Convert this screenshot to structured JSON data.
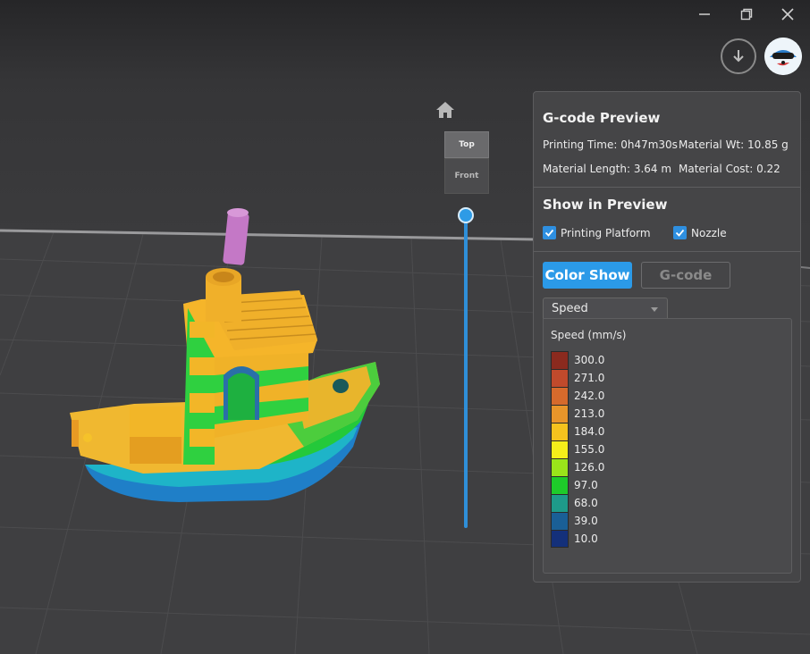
{
  "window": {
    "minimize_icon": "minimize-icon",
    "restore_icon": "restore-icon",
    "close_icon": "close-icon"
  },
  "toolbar": {
    "download_icon": "download-arrow-icon",
    "avatar_icon": "user-avatar"
  },
  "view_cube": {
    "home_icon": "home-icon",
    "top_label": "Top",
    "front_label": "Front"
  },
  "layer_slider": {
    "position": 1.0
  },
  "panel": {
    "title": "G-code Preview",
    "printing_time_label": "Printing Time: 0h47m30s",
    "material_wt_label": "Material Wt: 10.85 g",
    "material_length_label": "Material Length: 3.64 m",
    "material_cost_label": "Material Cost: 0.22",
    "show_title": "Show in Preview",
    "printing_platform_label": "Printing Platform",
    "printing_platform_checked": true,
    "nozzle_label": "Nozzle",
    "nozzle_checked": true,
    "color_show_label": "Color Show",
    "gcode_label": "G-code",
    "mode_select": "Speed",
    "legend_title": "Speed (mm/s)",
    "legend": [
      {
        "value": "300.0",
        "color": "#8b2a1e"
      },
      {
        "value": "271.0",
        "color": "#c04a2c"
      },
      {
        "value": "242.0",
        "color": "#d66a2c"
      },
      {
        "value": "213.0",
        "color": "#e8952a"
      },
      {
        "value": "184.0",
        "color": "#f5c21e"
      },
      {
        "value": "155.0",
        "color": "#f5ee1a"
      },
      {
        "value": "126.0",
        "color": "#9ae41a"
      },
      {
        "value": "97.0",
        "color": "#1ecb2a"
      },
      {
        "value": "68.0",
        "color": "#1e9a8a"
      },
      {
        "value": "39.0",
        "color": "#1a5f96"
      },
      {
        "value": "10.0",
        "color": "#14307a"
      }
    ]
  },
  "colors": {
    "accent": "#2b9ae8",
    "panel_bg": "#454547",
    "viewport_bg": "#3a3a3c"
  }
}
